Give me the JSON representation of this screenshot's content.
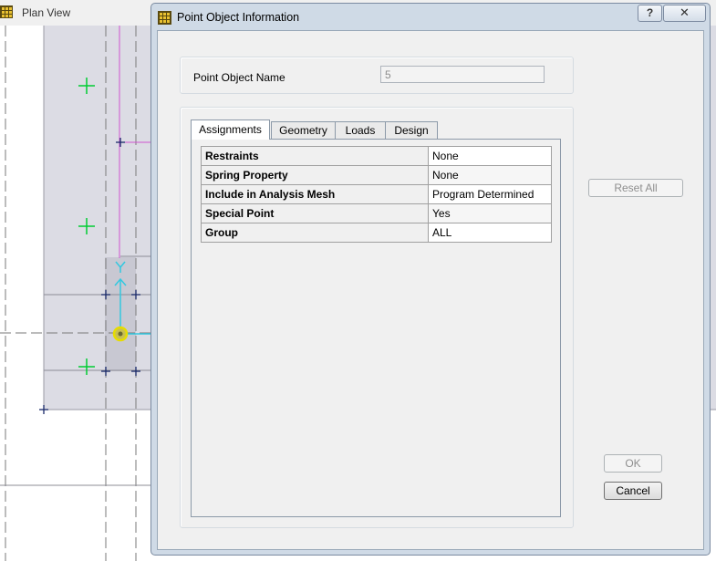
{
  "plan_view": {
    "title": "Plan View"
  },
  "dialog": {
    "title": "Point Object Information",
    "help_label": "?",
    "close_label": "✕",
    "name_label": "Point Object Name",
    "name_value": "5",
    "tabs": [
      {
        "label": "Assignments",
        "active": true
      },
      {
        "label": "Geometry"
      },
      {
        "label": "Loads"
      },
      {
        "label": "Design"
      }
    ],
    "assignments": [
      {
        "key": "Restraints",
        "value": "None"
      },
      {
        "key": "Spring Property",
        "value": "None"
      },
      {
        "key": "Include in Analysis Mesh",
        "value": "Program Determined"
      },
      {
        "key": "Special Point",
        "value": "Yes"
      },
      {
        "key": "Group",
        "value": "ALL"
      }
    ],
    "reset_label": "Reset All",
    "ok_label": "OK",
    "cancel_label": "Cancel"
  },
  "colors": {
    "accent_green": "#00cc33",
    "accent_cyan": "#33c8e0",
    "selection_yellow": "#e6dc00",
    "grid_magenta": "#d055d0"
  }
}
